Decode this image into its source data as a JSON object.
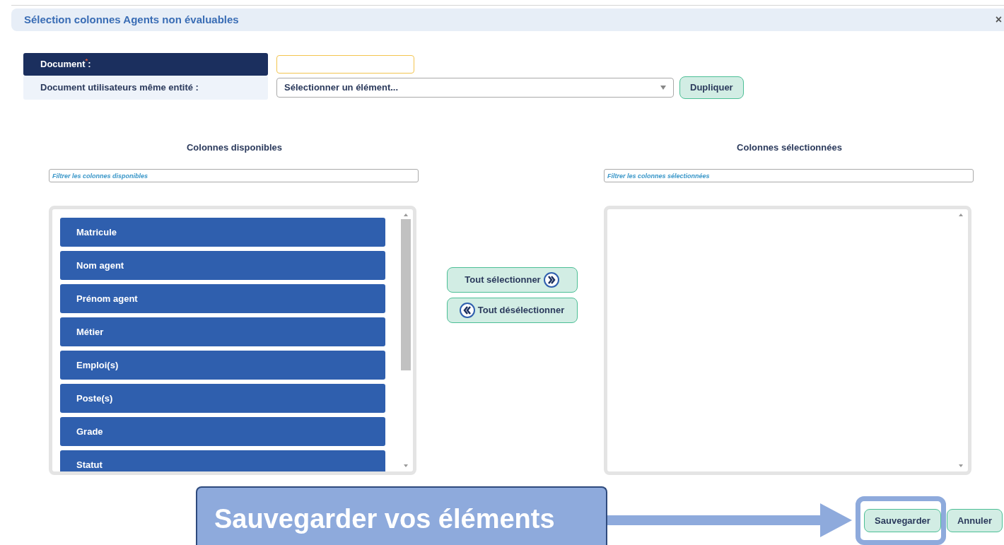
{
  "dialog": {
    "title": "Sélection colonnes Agents non évaluables",
    "close": "×"
  },
  "form": {
    "document": {
      "label": "Document",
      "required_mark": "*",
      "colon": " :",
      "focused": true
    },
    "shared_document": {
      "label": "Document utilisateurs même entité :",
      "placeholder": "Sélectionner un élément...",
      "button": "Dupliquer"
    }
  },
  "available_columns": {
    "heading": "Colonnes disponibles",
    "filter_placeholder": "Filtrer les colonnes disponibles",
    "items": [
      "Matricule",
      "Nom agent",
      "Prénom agent",
      "Métier",
      "Emploi(s)",
      "Poste(s)",
      "Grade",
      "Statut"
    ]
  },
  "transfer_buttons": [
    {
      "label": "Tout sélectionner",
      "kind": "select-all"
    },
    {
      "label": "Tout désélectionner",
      "kind": "deselect-all"
    }
  ],
  "selected_columns": {
    "heading": "Colonnes sélectionnées",
    "filter_placeholder": "Filtrer les colonnes sélectionnées"
  },
  "footer_buttons": [
    {
      "label": "Sauvegarder",
      "highlighted": true
    },
    {
      "label": "Annuler",
      "highlighted": false
    }
  ],
  "annotation": {
    "callout": "Sauvegarder vos éléments"
  }
}
